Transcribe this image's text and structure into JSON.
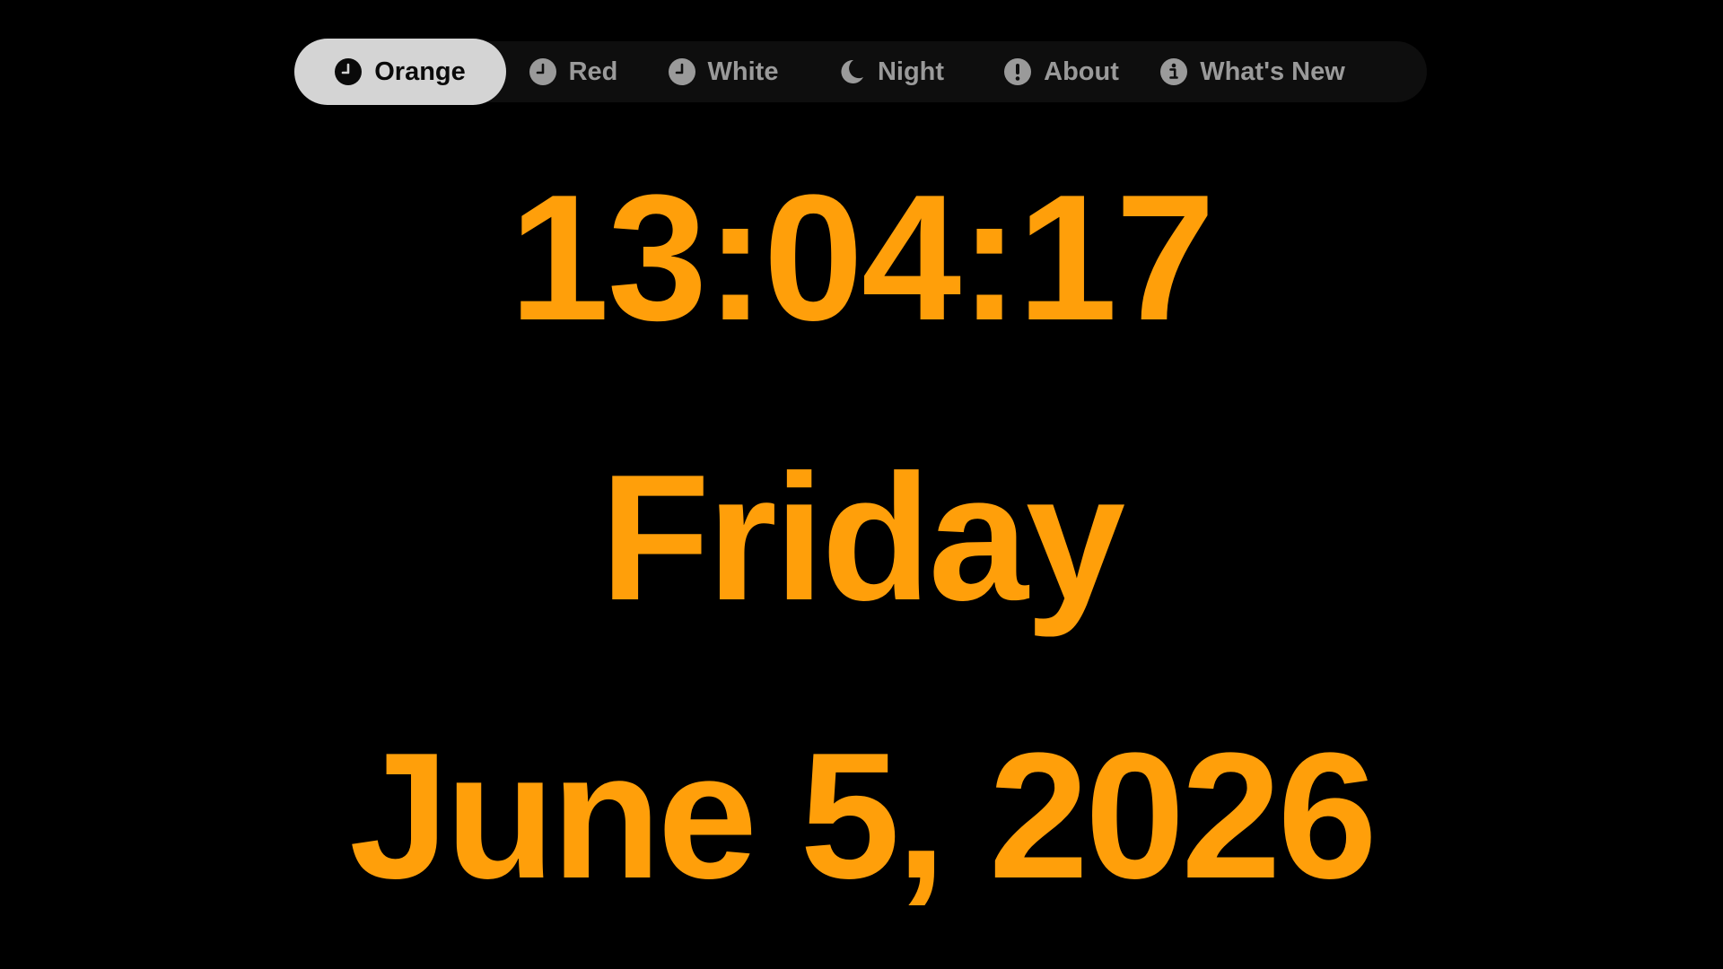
{
  "theme": {
    "accent": "#ff9f0a",
    "tab_bar_bg": "#0e0e0e",
    "tab_selected_bg": "#d4d4d4",
    "tab_text": "#9a9a9a",
    "tab_selected_text": "#0a0a0a"
  },
  "tabs": [
    {
      "label": "Orange",
      "icon": "clock-icon",
      "selected": true
    },
    {
      "label": "Red",
      "icon": "clock-icon",
      "selected": false
    },
    {
      "label": "White",
      "icon": "clock-icon",
      "selected": false
    },
    {
      "label": "Night",
      "icon": "moon-icon",
      "selected": false
    },
    {
      "label": "About",
      "icon": "exclamation-circle-icon",
      "selected": false
    },
    {
      "label": "What's New",
      "icon": "info-circle-icon",
      "selected": false
    }
  ],
  "clock": {
    "time": "13:04:17",
    "day": "Friday",
    "date": "June 5, 2026"
  }
}
